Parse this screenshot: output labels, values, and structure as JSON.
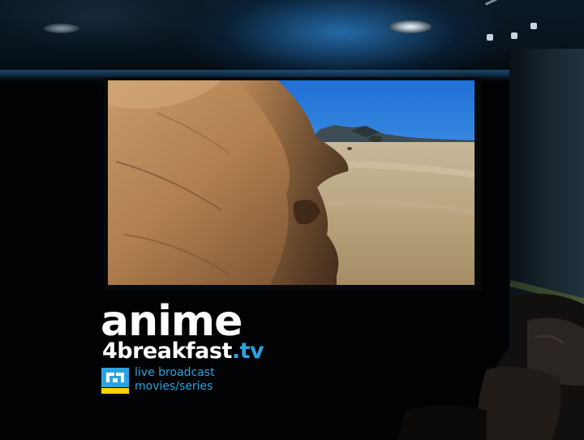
{
  "brand": {
    "name_main": "anime",
    "name_prefix": "4breakfast",
    "name_tld": ".tv",
    "tagline_1": "live broadcast",
    "tagline_2": "movies/series",
    "text_color": "#ffffff",
    "accent_color": "#2aa4e0",
    "badge_colors": [
      "#2aa4e0",
      "#ffd200"
    ]
  },
  "scene": {
    "subject": "home-theater-screen",
    "screen_image": "desert-rock-formation",
    "icons": [
      "ceiling-downlight-icon",
      "track-light-icon",
      "logo-badge-icon"
    ]
  }
}
